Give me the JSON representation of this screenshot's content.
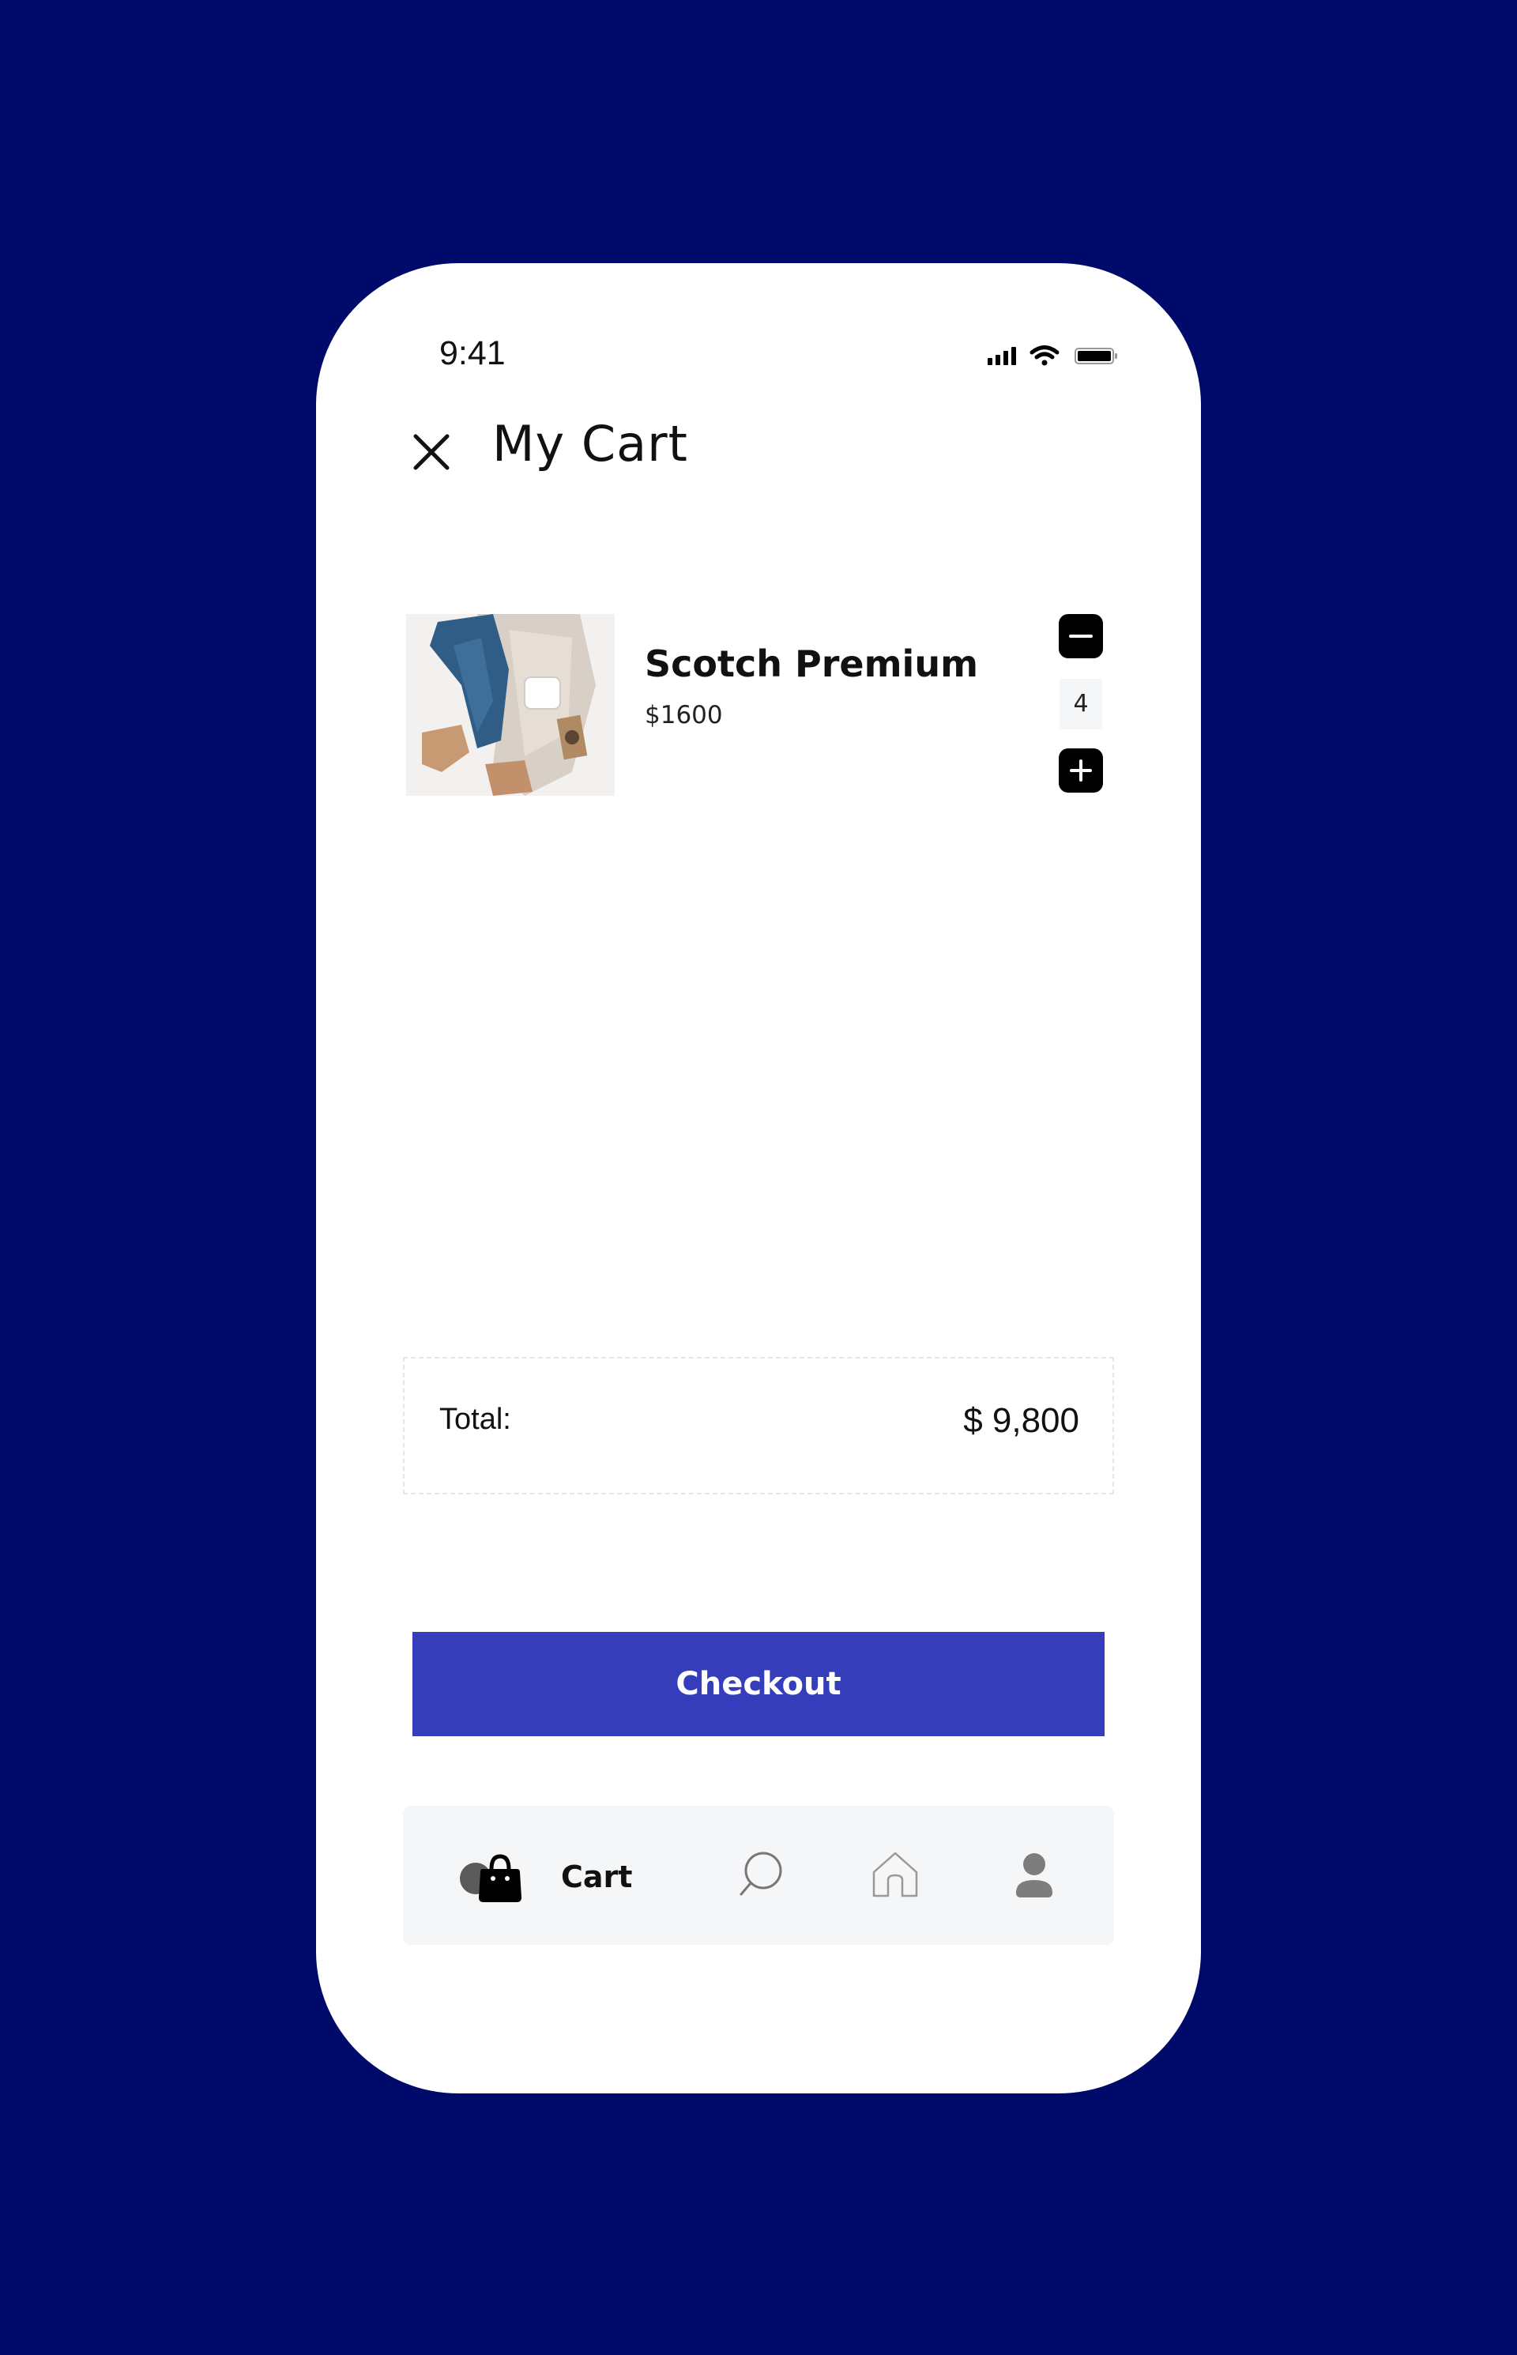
{
  "status_bar": {
    "time": "9:41",
    "signal_icon": "cellular-signal-icon",
    "wifi_icon": "wifi-icon",
    "battery_icon": "battery-icon"
  },
  "header": {
    "close_icon": "close-icon",
    "title": "My Cart"
  },
  "cart": {
    "items": [
      {
        "name": "Scotch Premium",
        "price": "$1600",
        "quantity": "4",
        "thumbnail": "product-photo"
      }
    ]
  },
  "summary": {
    "total_label": "Total:",
    "total_value": "$ 9,800"
  },
  "checkout": {
    "label": "Checkout"
  },
  "bottom_nav": {
    "cart_label": "Cart",
    "items": [
      "cart-bag-icon",
      "search-icon",
      "home-icon",
      "profile-icon"
    ]
  },
  "colors": {
    "background": "#000a6b",
    "accent": "#363dbb",
    "surface": "#ffffff",
    "nav_background": "#f4f6f8"
  }
}
